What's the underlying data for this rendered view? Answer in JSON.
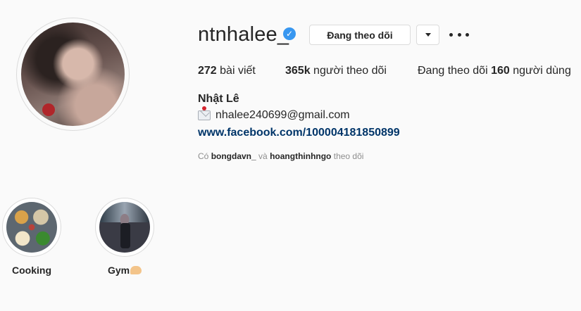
{
  "profile": {
    "username": "ntnhalee_",
    "verified_icon": "verified-badge-icon",
    "full_name": "Nhật Lê",
    "email": "nhalee240699@gmail.com",
    "website": "www.facebook.com/100004181850899"
  },
  "actions": {
    "follow_label": "Đang theo dõi",
    "dropdown_icon": "caret-down-icon",
    "more_icon": "more-options-icon"
  },
  "stats": {
    "posts_count": "272",
    "posts_label": "bài viết",
    "followers_count": "365k",
    "followers_label": "người theo dõi",
    "following_prefix": "Đang theo dõi",
    "following_count": "160",
    "following_label": "người dùng"
  },
  "followed_by": {
    "prefix": "Có",
    "user1": "bongdavn_",
    "joiner": "và",
    "user2": "hoangthinhngo",
    "suffix": "theo dõi"
  },
  "highlights": [
    {
      "label": "Cooking"
    },
    {
      "label": "Gym"
    }
  ],
  "colors": {
    "accent_blue": "#3897f0",
    "link": "#003569",
    "muted": "#8e8e8e",
    "background": "#fafafa"
  }
}
